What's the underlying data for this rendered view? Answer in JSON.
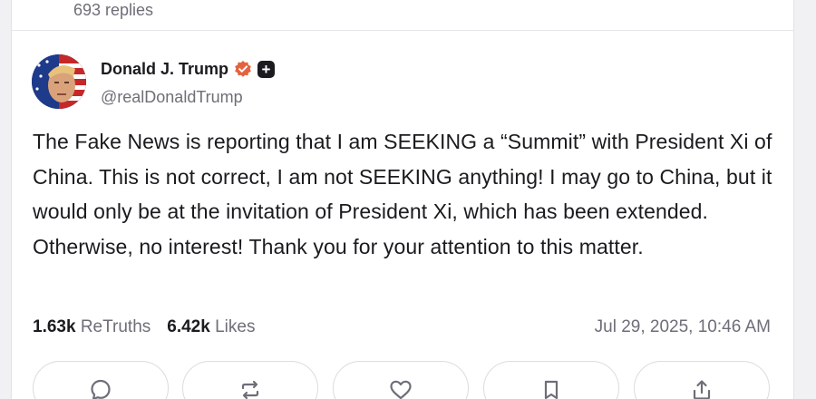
{
  "previous_post": {
    "replies_label": "693 replies"
  },
  "post": {
    "author": {
      "display_name": "Donald J. Trump",
      "handle": "@realDonaldTrump",
      "verified_icon": "verified-check-icon",
      "plus_badge": "+"
    },
    "body": "The Fake News is reporting that I am SEEKING a “Summit” with President Xi of China. This is not correct, I am not SEEKING anything! I may go to China, but it would only be at the invitation of President Xi, which has been extended. Otherwise, no interest! Thank you for your attention to this matter.",
    "stats": {
      "retruths_count": "1.63k",
      "retruths_label": "ReTruths",
      "likes_count": "6.42k",
      "likes_label": "Likes"
    },
    "timestamp": "Jul 29, 2025, 10:46 AM",
    "actions": [
      {
        "name": "reply",
        "icon": "reply-bubble-icon"
      },
      {
        "name": "retruth",
        "icon": "retruth-arrows-icon"
      },
      {
        "name": "like",
        "icon": "heart-icon"
      },
      {
        "name": "bookmark",
        "icon": "bookmark-icon"
      },
      {
        "name": "share",
        "icon": "share-icon"
      }
    ]
  },
  "colors": {
    "verified_badge": "#e4633f",
    "text_primary": "#1b1b1f",
    "text_secondary": "#6e6e78"
  }
}
